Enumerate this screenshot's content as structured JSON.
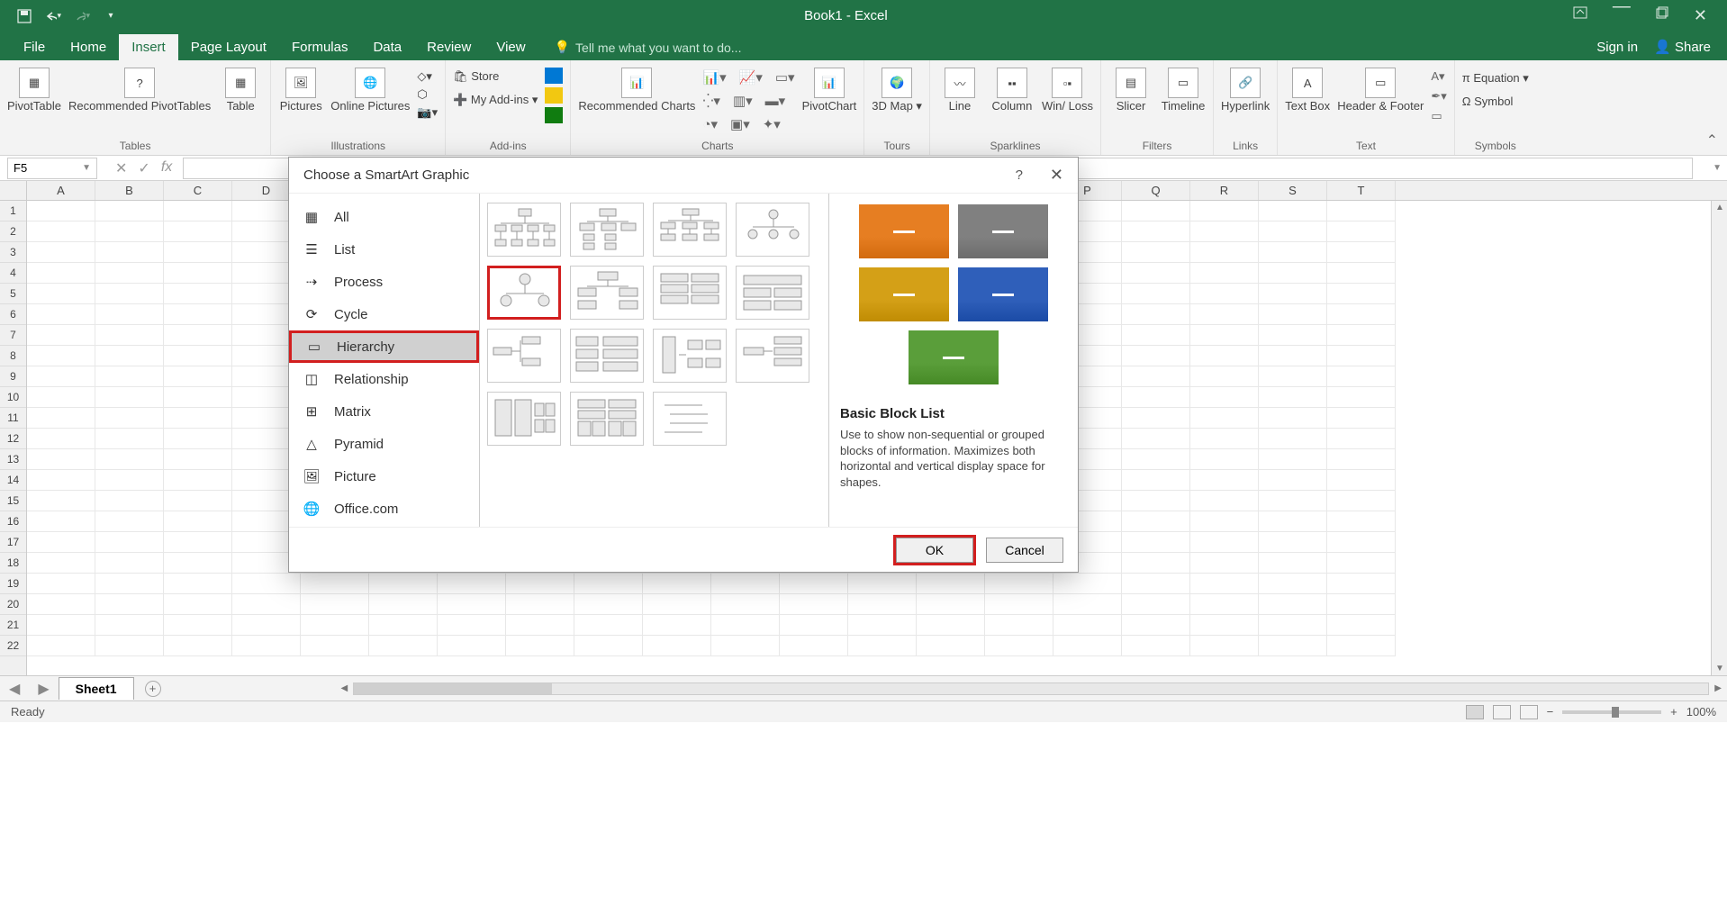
{
  "title": "Book1 - Excel",
  "tabs": [
    "File",
    "Home",
    "Insert",
    "Page Layout",
    "Formulas",
    "Data",
    "Review",
    "View"
  ],
  "active_tab": "Insert",
  "tellme": "Tell me what you want to do...",
  "signin": "Sign in",
  "share": "Share",
  "ribbon": {
    "groups": {
      "tables": {
        "label": "Tables",
        "items": [
          "PivotTable",
          "Recommended PivotTables",
          "Table"
        ]
      },
      "illustrations": {
        "label": "Illustrations",
        "items": [
          "Pictures",
          "Online Pictures"
        ]
      },
      "addins": {
        "label": "Add-ins",
        "store": "Store",
        "myaddins": "My Add-ins"
      },
      "charts": {
        "label": "Charts",
        "recommended": "Recommended Charts",
        "pivotchart": "PivotChart"
      },
      "tours": {
        "label": "Tours",
        "map": "3D Map"
      },
      "sparklines": {
        "label": "Sparklines",
        "items": [
          "Line",
          "Column",
          "Win/ Loss"
        ]
      },
      "filters": {
        "label": "Filters",
        "items": [
          "Slicer",
          "Timeline"
        ]
      },
      "links": {
        "label": "Links",
        "item": "Hyperlink"
      },
      "text": {
        "label": "Text",
        "items": [
          "Text Box",
          "Header & Footer"
        ]
      },
      "symbols": {
        "label": "Symbols",
        "equation": "Equation",
        "symbol": "Symbol"
      }
    }
  },
  "namebox": "F5",
  "columns": [
    "A",
    "B",
    "C",
    "D",
    "",
    "",
    "",
    "",
    "",
    "",
    "",
    "",
    "",
    "",
    "",
    "P",
    "Q",
    "R",
    "S",
    "T"
  ],
  "rows": [
    "1",
    "2",
    "3",
    "4",
    "5",
    "6",
    "7",
    "8",
    "9",
    "10",
    "11",
    "12",
    "13",
    "14",
    "15",
    "16",
    "17",
    "18",
    "19",
    "20",
    "21",
    "22"
  ],
  "sheet": "Sheet1",
  "status": "Ready",
  "zoom": "100%",
  "dialog": {
    "title": "Choose a SmartArt Graphic",
    "categories": [
      "All",
      "List",
      "Process",
      "Cycle",
      "Hierarchy",
      "Relationship",
      "Matrix",
      "Pyramid",
      "Picture",
      "Office.com"
    ],
    "selected_category": "Hierarchy",
    "preview": {
      "title": "Basic Block List",
      "description": "Use to show non-sequential or grouped blocks of information. Maximizes both horizontal and vertical display space for shapes.",
      "colors": [
        "#e67e22",
        "#808080",
        "#d4a017",
        "#2f5fba",
        "#5a9e3a"
      ]
    },
    "ok": "OK",
    "cancel": "Cancel"
  }
}
